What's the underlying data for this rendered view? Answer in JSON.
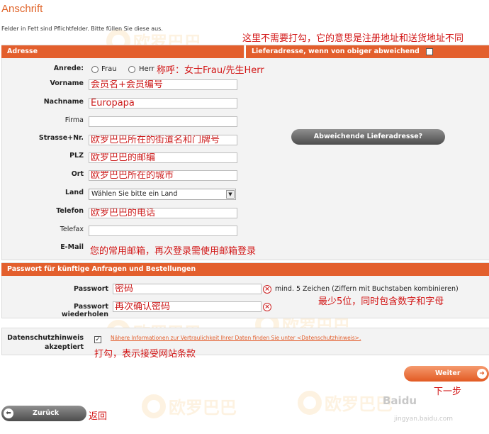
{
  "page": {
    "title": "Anschrift",
    "required_hint": "Felder in Fett sind Pflichtfelder. Bitte füllen Sie diese aus."
  },
  "sections": {
    "address": "Adresse",
    "delivery": "Lieferadresse, wenn von obiger abweichend",
    "password": "Passwort für künftige Anfragen und Bestellungen"
  },
  "address": {
    "salutation_label": "Anrede:",
    "salutation_options": [
      "Frau",
      "Herr"
    ],
    "fields": {
      "vorname": {
        "label": "Vorname",
        "value": "会员名+会员编号"
      },
      "nachname": {
        "label": "Nachname",
        "value": "Europapa"
      },
      "firma": {
        "label": "Firma",
        "value": ""
      },
      "strasse": {
        "label": "Strasse+Nr.",
        "value": "欧罗巴巴所在的街道名和门牌号"
      },
      "plz": {
        "label": "PLZ",
        "value": "欧罗巴巴的邮编"
      },
      "ort": {
        "label": "Ort",
        "value": "欧罗巴巴所在的城市"
      },
      "land": {
        "label": "Land",
        "value": "Wählen Sie bitte ein Land"
      },
      "telefon": {
        "label": "Telefon",
        "value": "欧罗巴巴的电话"
      },
      "telefax": {
        "label": "Telefax",
        "value": ""
      },
      "email": {
        "label": "E-Mail",
        "value": "您的常用邮箱，再次登录需使用邮箱登录"
      }
    }
  },
  "delivery": {
    "button": "Abweichende Lieferadresse?"
  },
  "password": {
    "passwort_label": "Passwort",
    "passwort_value": "密码",
    "repeat_label": "Passwort wiederholen",
    "repeat_value": "再次确认密码",
    "rule": "mind. 5 Zeichen (Ziffern mit Buchstaben kombinieren)"
  },
  "privacy": {
    "label_line1": "Datenschutzhinweis",
    "label_line2": "akzeptiert",
    "checkbox_mark": "✓",
    "link": "Nähere Informationen zur Vertraulichkeit Ihrer Daten finden Sie unter <Datenschutzhinweis>."
  },
  "buttons": {
    "weiter": "Weiter",
    "zurueck": "Zurück"
  },
  "annotations": {
    "no_check": "这里不需要打勾，它的意思是注册地址和送货地址不同",
    "salutation": "称呼：女士Frau/先生Herr",
    "password_rule": "最少5位，同时包含数字和字母",
    "checkbox": "打勾，表示接受网站条款",
    "next": "下一步",
    "back": "返回"
  },
  "watermarks": {
    "brand_cn": "欧罗巴巴",
    "brand_en": "WWW.EUROPAPA.DE"
  },
  "colors": {
    "accent": "#e35f2d",
    "annotation": "#d21616"
  }
}
